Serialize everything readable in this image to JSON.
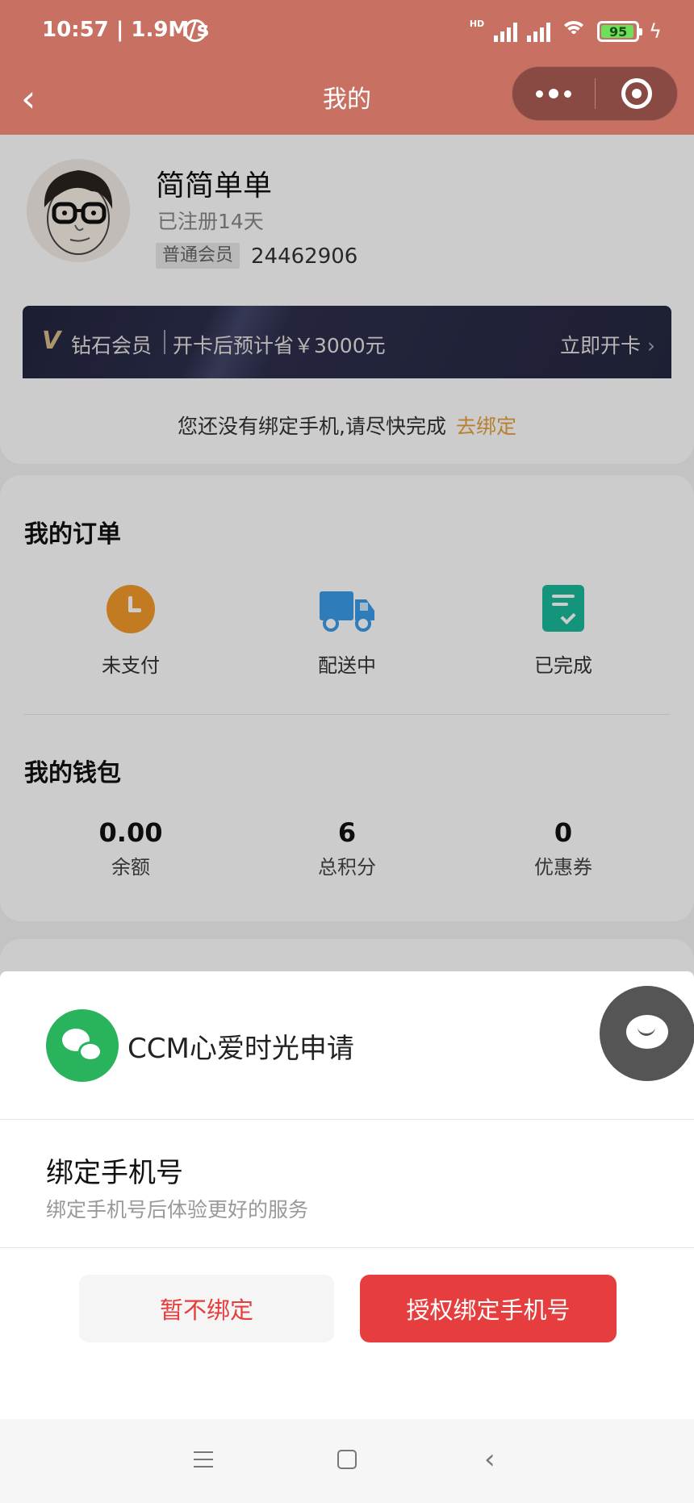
{
  "status_bar": {
    "time": "10:57 | 1.9M/s",
    "battery": "95",
    "network_label": "HD"
  },
  "nav": {
    "title": "我的",
    "back_icon": "chevron-left-icon"
  },
  "profile": {
    "name": "简简单单",
    "registered": "已注册14天",
    "level": "普通会员",
    "member_id": "24462906"
  },
  "vip": {
    "mark": "V",
    "title": "钻石会员",
    "description": "开卡后预计省￥3000元",
    "action": "立即开卡"
  },
  "bind_tip": {
    "text": "您还没有绑定手机,请尽快完成",
    "link": "去绑定"
  },
  "orders": {
    "title": "我的订单",
    "items": [
      {
        "label": "未支付",
        "icon": "clock-icon",
        "color": "#f39a2a"
      },
      {
        "label": "配送中",
        "icon": "truck-icon",
        "color": "#3a9be8"
      },
      {
        "label": "已完成",
        "icon": "checklist-icon",
        "color": "#19b99a"
      }
    ]
  },
  "wallet": {
    "title": "我的钱包",
    "items": [
      {
        "value": "0.00",
        "label": "余额"
      },
      {
        "value": "6",
        "label": "总积分"
      },
      {
        "value": "0",
        "label": "优惠券"
      }
    ]
  },
  "sheet": {
    "app_name": "CCM心爱时光申请",
    "permission_title": "绑定手机号",
    "permission_desc": "绑定手机号后体验更好的服务",
    "decline": "暂不绑定",
    "accept": "授权绑定手机号"
  },
  "colors": {
    "header": "#c87163",
    "accent": "#e63e3e",
    "link": "#e7a23b"
  }
}
